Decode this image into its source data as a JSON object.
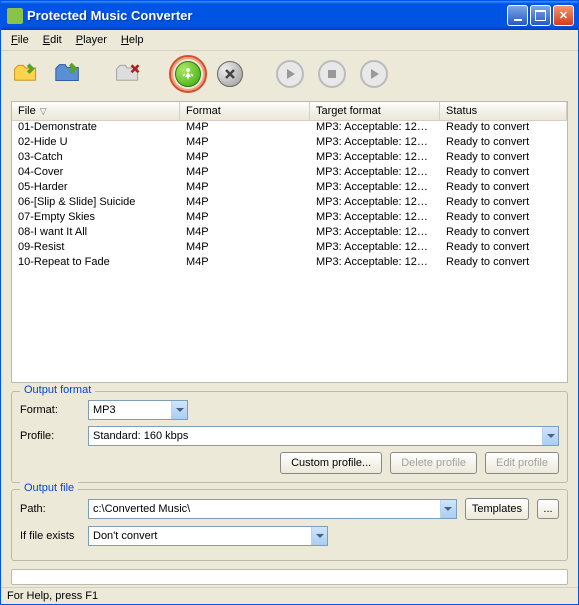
{
  "window": {
    "title": "Protected Music Converter"
  },
  "menu": {
    "file": "File",
    "edit": "Edit",
    "player": "Player",
    "help": "Help"
  },
  "columns": {
    "file": "File",
    "format": "Format",
    "target": "Target format",
    "status": "Status"
  },
  "files": [
    {
      "name": "01-Demonstrate",
      "format": "M4P",
      "target": "MP3: Acceptable: 128 ...",
      "status": "Ready to convert"
    },
    {
      "name": "02-Hide U",
      "format": "M4P",
      "target": "MP3: Acceptable: 128 ...",
      "status": "Ready to convert"
    },
    {
      "name": "03-Catch",
      "format": "M4P",
      "target": "MP3: Acceptable: 128 ...",
      "status": "Ready to convert"
    },
    {
      "name": "04-Cover",
      "format": "M4P",
      "target": "MP3: Acceptable: 128 ...",
      "status": "Ready to convert"
    },
    {
      "name": "05-Harder",
      "format": "M4P",
      "target": "MP3: Acceptable: 128 ...",
      "status": "Ready to convert"
    },
    {
      "name": "06-[Slip & Slide] Suicide",
      "format": "M4P",
      "target": "MP3: Acceptable: 128 ...",
      "status": "Ready to convert"
    },
    {
      "name": "07-Empty Skies",
      "format": "M4P",
      "target": "MP3: Acceptable: 128 ...",
      "status": "Ready to convert"
    },
    {
      "name": "08-I want It All",
      "format": "M4P",
      "target": "MP3: Acceptable: 128 ...",
      "status": "Ready to convert"
    },
    {
      "name": "09-Resist",
      "format": "M4P",
      "target": "MP3: Acceptable: 128 ...",
      "status": "Ready to convert"
    },
    {
      "name": "10-Repeat to Fade",
      "format": "M4P",
      "target": "MP3: Acceptable: 128 ...",
      "status": "Ready to convert"
    }
  ],
  "output_format": {
    "legend": "Output format",
    "format_label": "Format:",
    "format_value": "MP3",
    "profile_label": "Profile:",
    "profile_value": "Standard: 160 kbps",
    "custom_profile": "Custom profile...",
    "delete_profile": "Delete profile",
    "edit_profile": "Edit profile"
  },
  "output_file": {
    "legend": "Output file",
    "path_label": "Path:",
    "path_value": "c:\\Converted Music\\",
    "templates": "Templates",
    "browse": "...",
    "exists_label": "If file exists",
    "exists_value": "Don't convert"
  },
  "statusbar": {
    "text": "For Help, press F1"
  }
}
